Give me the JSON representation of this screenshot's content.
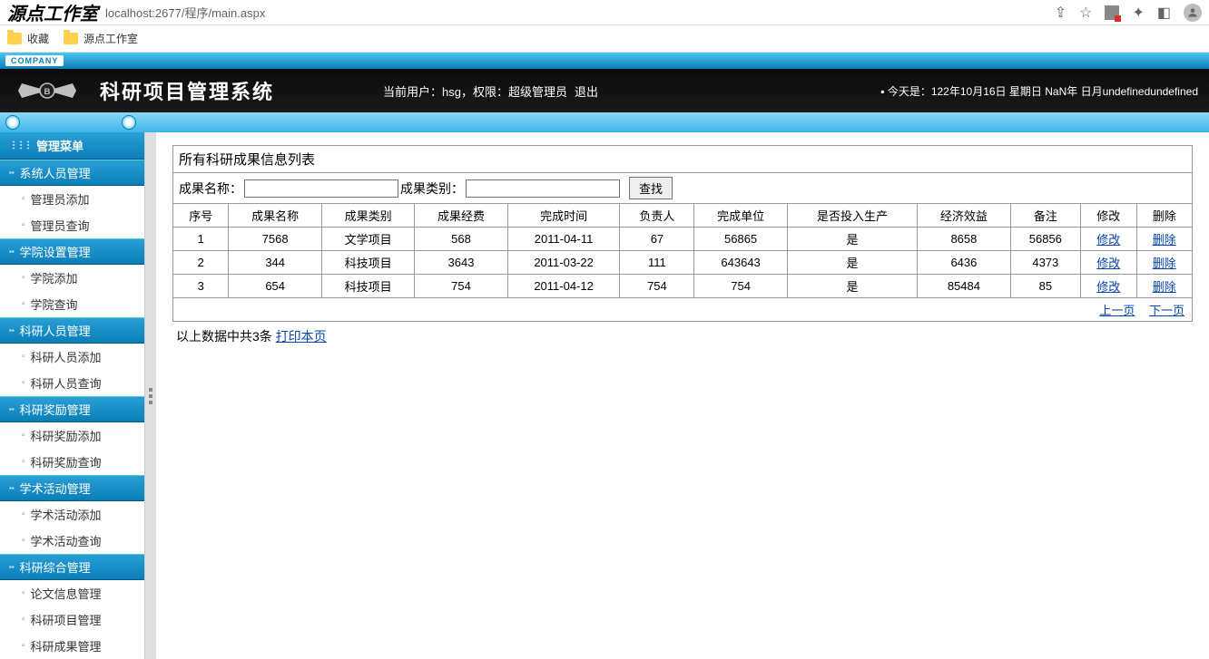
{
  "browser": {
    "tab_title": "源点工作室",
    "url": "localhost:2677/程序/main.aspx",
    "bookmarks": [
      "收藏",
      "源点工作室"
    ]
  },
  "header": {
    "company_label": "COMPANY",
    "app_title": "科研项目管理系统",
    "user_info": "当前用户：hsg，权限：超级管理员",
    "logout": "退出",
    "date_info": "▪ 今天是：122年10月16日 星期日 NaN年 日月undefinedundefined"
  },
  "sidebar": {
    "menu_title": "管理菜单",
    "sections": [
      {
        "label": "系统人员管理",
        "items": [
          "管理员添加",
          "管理员查询"
        ]
      },
      {
        "label": "学院设置管理",
        "items": [
          "学院添加",
          "学院查询"
        ]
      },
      {
        "label": "科研人员管理",
        "items": [
          "科研人员添加",
          "科研人员查询"
        ]
      },
      {
        "label": "科研奖励管理",
        "items": [
          "科研奖励添加",
          "科研奖励查询"
        ]
      },
      {
        "label": "学术活动管理",
        "items": [
          "学术活动添加",
          "学术活动查询"
        ]
      },
      {
        "label": "科研综合管理",
        "items": [
          "论文信息管理",
          "科研项目管理",
          "科研成果管理"
        ]
      }
    ]
  },
  "content": {
    "panel_title": "所有科研成果信息列表",
    "search": {
      "name_label": "成果名称：",
      "type_label": "成果类别：",
      "button": "查找"
    },
    "table": {
      "headers": [
        "序号",
        "成果名称",
        "成果类别",
        "成果经费",
        "完成时间",
        "负责人",
        "完成单位",
        "是否投入生产",
        "经济效益",
        "备注",
        "修改",
        "删除"
      ],
      "rows": [
        {
          "cells": [
            "1",
            "7568",
            "文学项目",
            "568",
            "2011-04-11",
            "67",
            "56865",
            "是",
            "8658",
            "56856"
          ],
          "edit": "修改",
          "del": "删除"
        },
        {
          "cells": [
            "2",
            "344",
            "科技项目",
            "3643",
            "2011-03-22",
            "111",
            "643643",
            "是",
            "6436",
            "4373"
          ],
          "edit": "修改",
          "del": "删除"
        },
        {
          "cells": [
            "3",
            "654",
            "科技项目",
            "754",
            "2011-04-12",
            "754",
            "754",
            "是",
            "85484",
            "85"
          ],
          "edit": "修改",
          "del": "删除"
        }
      ]
    },
    "pager": {
      "prev": "上一页",
      "next": "下一页"
    },
    "summary": {
      "text": "以上数据中共3条 ",
      "print": "打印本页"
    }
  }
}
